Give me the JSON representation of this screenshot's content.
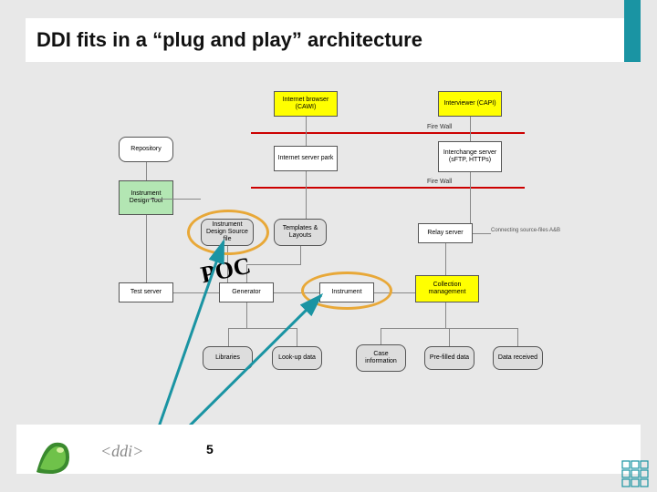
{
  "title": "DDI fits in a “plug and play” architecture",
  "page_number": "5",
  "logo_text": "<ddi>",
  "annotations": {
    "poc": "POC"
  },
  "firewall": {
    "label": "Fire Wall"
  },
  "boxes": {
    "internet_browser": "Internet browser (CAWI)",
    "interviewer": "Interviewer (CAPI)",
    "repository": "Repository",
    "internet_server": "Internet server park",
    "interchange": "Interchange server (sFTP, HTTPs)",
    "instrument_design_tool": "Instrument Design Tool",
    "instrument_design_source": "Instrument Design Source file",
    "templates": "Templates & Layouts",
    "relay_server": "Relay server",
    "connecting": "Connecting source-files A&B",
    "test_server": "Test server",
    "generator": "Generator",
    "instrument": "Instrument",
    "collection_mgmt": "Collection management",
    "libraries": "Libraries",
    "lookup_data": "Look-up data",
    "case_info": "Case information",
    "prefilled": "Pre-filled data",
    "data_received": "Data received"
  }
}
